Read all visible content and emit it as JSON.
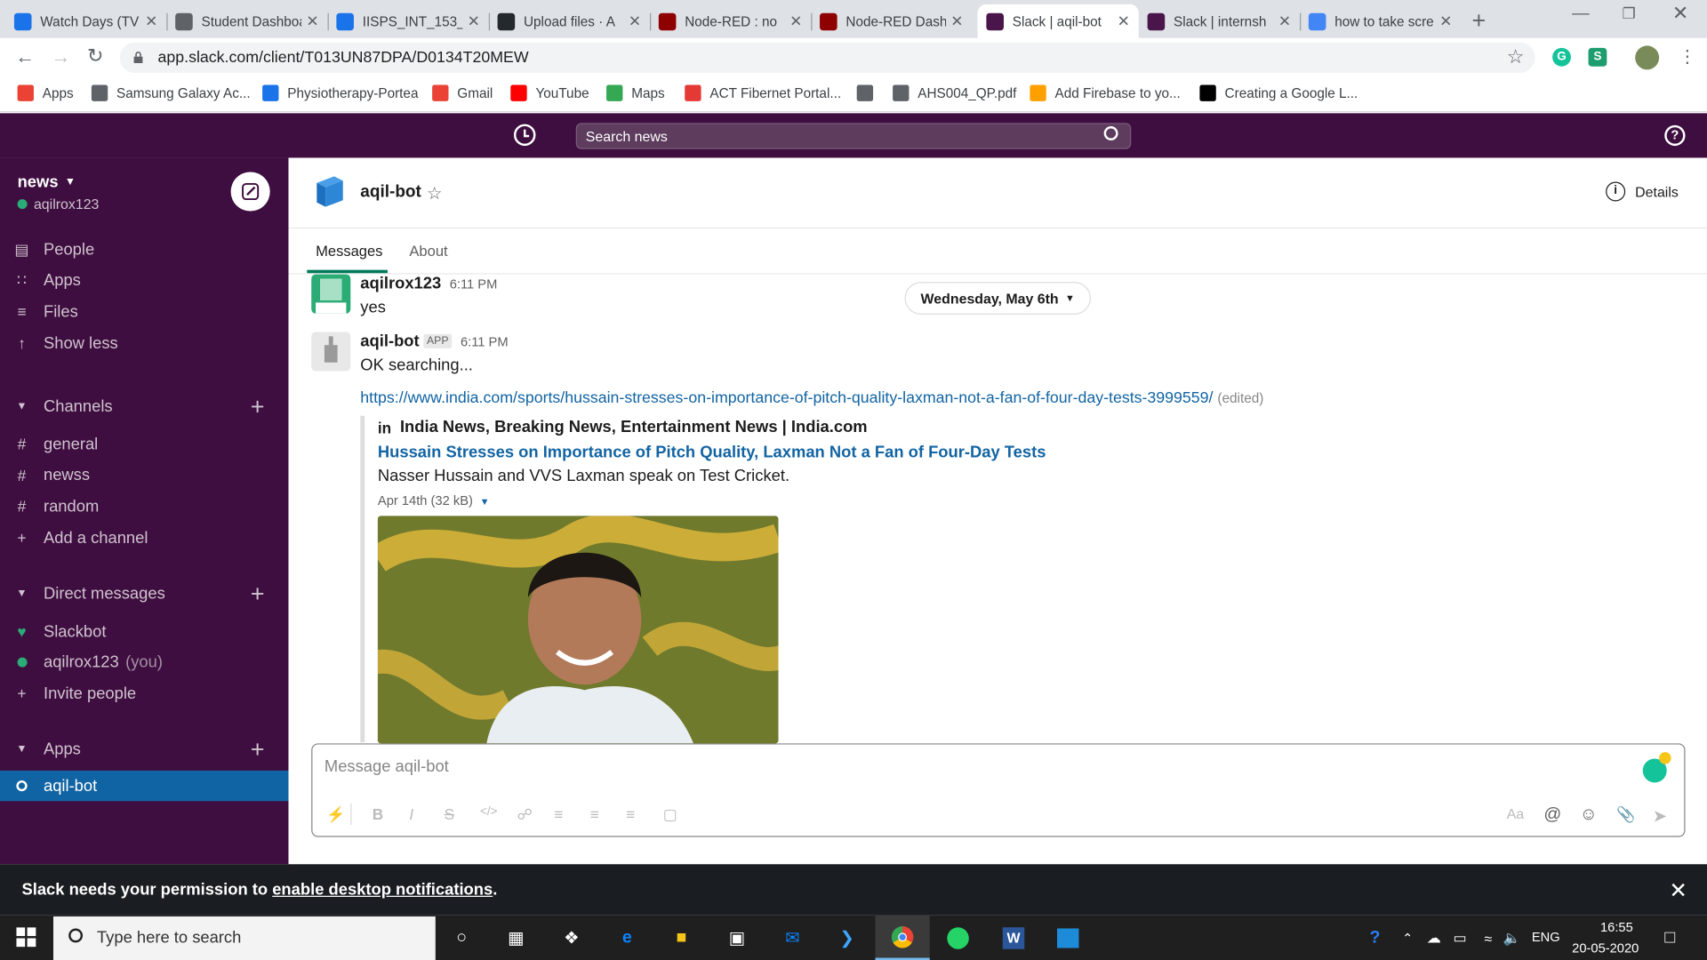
{
  "browser": {
    "tabs": [
      {
        "title": "Watch Days (TV",
        "favicon": "play-circle-icon",
        "color": "#1a73e8"
      },
      {
        "title": "Student Dashboa",
        "favicon": "globe-icon",
        "color": "#5f6368"
      },
      {
        "title": "IISPS_INT_153_",
        "favicon": "document-icon",
        "color": "#1a73e8"
      },
      {
        "title": "Upload files · A",
        "favicon": "github-icon",
        "color": "#24292e"
      },
      {
        "title": "Node-RED : no",
        "favicon": "node-red-icon",
        "color": "#8f0000"
      },
      {
        "title": "Node-RED Dash",
        "favicon": "node-red-icon",
        "color": "#8f0000"
      },
      {
        "title": "Slack | aqil-bot",
        "favicon": "slack-icon",
        "color": "#4a154b"
      },
      {
        "title": "Slack | internsh",
        "favicon": "slack-icon",
        "color": "#4a154b"
      },
      {
        "title": "how to take scre",
        "favicon": "google-icon",
        "color": "#4285f4"
      }
    ],
    "url": "app.slack.com/client/T013UN87DPA/D0134T20MEW",
    "bookmarks": [
      {
        "label": "Apps",
        "icon": "apps-grid-icon",
        "color": "#ea4335"
      },
      {
        "label": "Samsung Galaxy Ac...",
        "icon": "globe-icon",
        "color": "#5f6368"
      },
      {
        "label": "Physiotherapy-Portea",
        "icon": "portea-icon",
        "color": "#1a73e8"
      },
      {
        "label": "Gmail",
        "icon": "gmail-icon",
        "color": "#ea4335"
      },
      {
        "label": "YouTube",
        "icon": "youtube-icon",
        "color": "#ff0000"
      },
      {
        "label": "Maps",
        "icon": "maps-icon",
        "color": "#34a853"
      },
      {
        "label": "ACT Fibernet Portal...",
        "icon": "act-icon",
        "color": "#e53935"
      },
      {
        "label": "",
        "icon": "globe-icon",
        "color": "#5f6368"
      },
      {
        "label": "AHS004_QP.pdf",
        "icon": "globe-icon",
        "color": "#5f6368"
      },
      {
        "label": "Add Firebase to yo...",
        "icon": "firebase-icon",
        "color": "#ffa000"
      },
      {
        "label": "Creating a Google L...",
        "icon": "medium-icon",
        "color": "#000000"
      }
    ]
  },
  "slack": {
    "search_placeholder": "Search news",
    "workspace": "news",
    "user": "aqilrox123",
    "nav": [
      {
        "label": "People",
        "icon": "people-icon"
      },
      {
        "label": "Apps",
        "icon": "apps-icon"
      },
      {
        "label": "Files",
        "icon": "files-icon"
      },
      {
        "label": "Show less",
        "icon": "arrow-up-icon"
      }
    ],
    "channels_header": "Channels",
    "channels": [
      "general",
      "newss",
      "random"
    ],
    "add_channel": "Add a channel",
    "dm_header": "Direct messages",
    "dms": [
      {
        "label": "Slackbot",
        "suffix": ""
      },
      {
        "label": "aqilrox123",
        "suffix": "(you)"
      }
    ],
    "invite": "Invite people",
    "apps_header": "Apps",
    "active_app": "aqil-bot",
    "channel": {
      "name": "aqil-bot",
      "details": "Details",
      "tabs": [
        "Messages",
        "About"
      ],
      "date_divider": "Wednesday, May 6th"
    },
    "messages": [
      {
        "author": "aqilrox123",
        "time": "6:11 PM",
        "text": "yes",
        "badge": ""
      },
      {
        "author": "aqil-bot",
        "time": "6:11 PM",
        "text": "OK searching...",
        "badge": "APP"
      }
    ],
    "link": {
      "url": "https://www.india.com/sports/hussain-stresses-on-importance-of-pitch-quality-laxman-not-a-fan-of-four-day-tests-3999559/",
      "edited": "(edited)",
      "site": "India News, Breaking News, Entertainment News | India.com",
      "site_logo": "in",
      "title": "Hussain Stresses on Importance of Pitch Quality, Laxman Not a Fan of Four-Day Tests",
      "description": "Nasser Hussain and VVS Laxman speak on Test Cricket.",
      "meta": "Apr 14th (32 kB)"
    },
    "composer_placeholder": "Message aqil-bot",
    "notification": {
      "prefix": "Slack needs your permission to ",
      "link": "enable desktop notifications",
      "suffix": "."
    }
  },
  "taskbar": {
    "search_placeholder": "Type here to search",
    "lang": "ENG",
    "time": "16:55",
    "date": "20-05-2020"
  }
}
